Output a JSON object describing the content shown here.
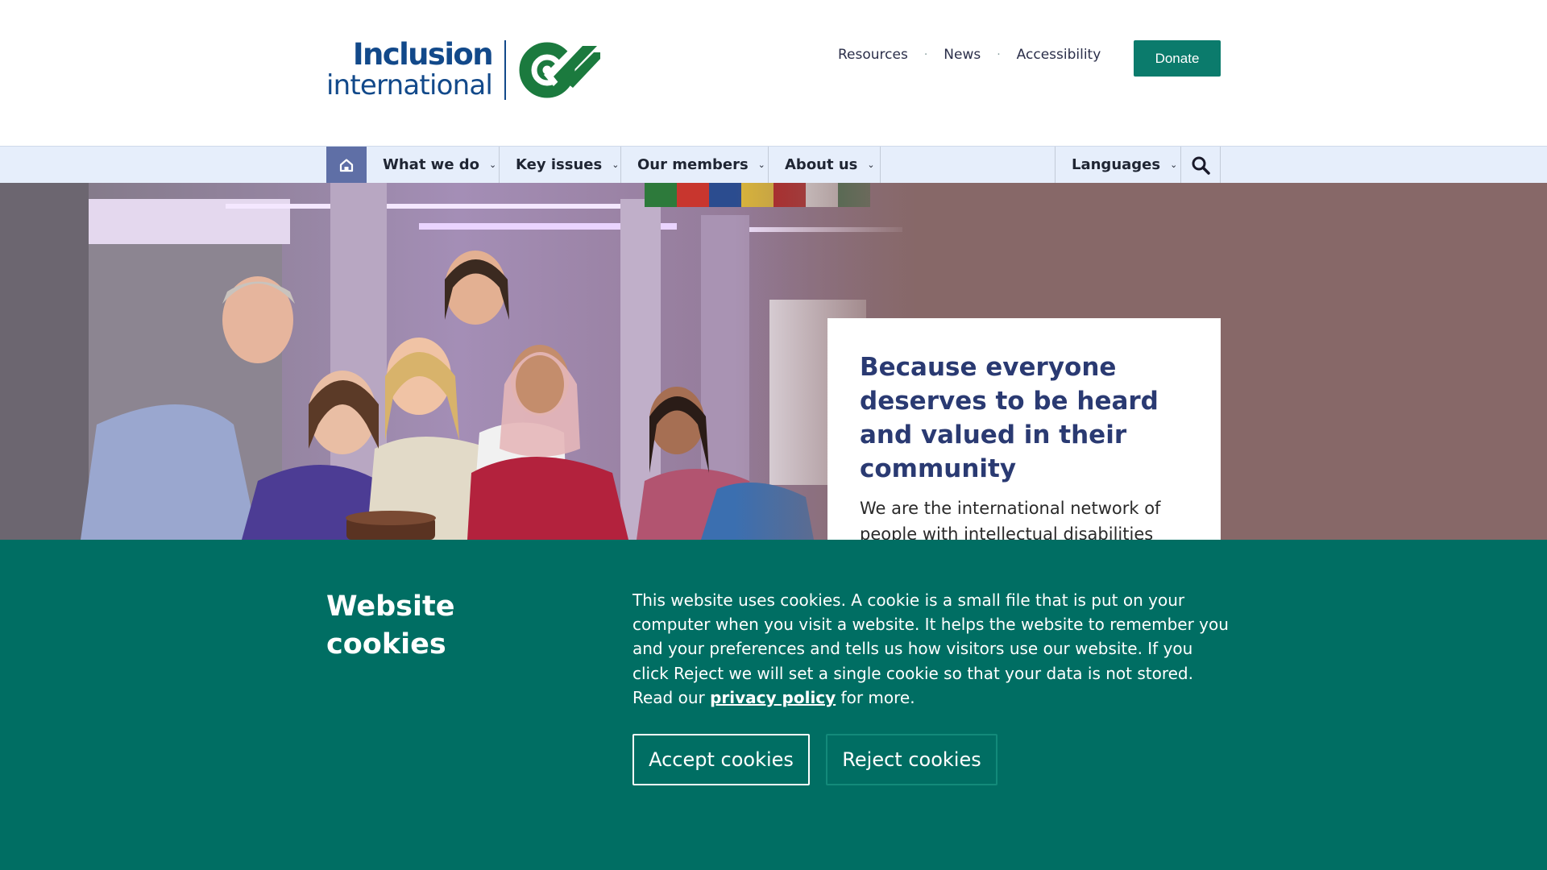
{
  "header": {
    "logo": {
      "line1": "Inclusion",
      "line2": "international"
    },
    "utility_nav": [
      "Resources",
      "News",
      "Accessibility"
    ],
    "separator": "·",
    "donate_label": "Donate"
  },
  "main_nav": {
    "home_icon": "home-icon",
    "items": [
      "What we do",
      "Key issues",
      "Our members",
      "About us"
    ],
    "languages_label": "Languages",
    "search_icon": "search-icon",
    "chevron": "⌄"
  },
  "hero": {
    "heading": "Because everyone deserves to be heard and valued in their community",
    "text": "We are the international network of people with intellectual disabilities and"
  },
  "cookie_banner": {
    "title": "Website cookies",
    "body_before": "This website uses cookies. A cookie is a small file that is put on your computer when you visit a website. It helps the website to remember you and your preferences and tells us how visitors use our website. If you click Reject we will set a single cookie so that your data is not stored. Read our ",
    "link_text": "privacy policy",
    "body_after": " for more.",
    "accept_label": "Accept cookies",
    "reject_label": "Reject cookies"
  },
  "colors": {
    "brand_blue": "#12498a",
    "brand_green": "#1b7a3e",
    "teal": "#006e63",
    "donate": "#0b7b6c",
    "nav_bg": "#e6eefb",
    "home_btn": "#5f6fa6",
    "hero_bg": "#876868",
    "heading": "#2a3a72"
  }
}
